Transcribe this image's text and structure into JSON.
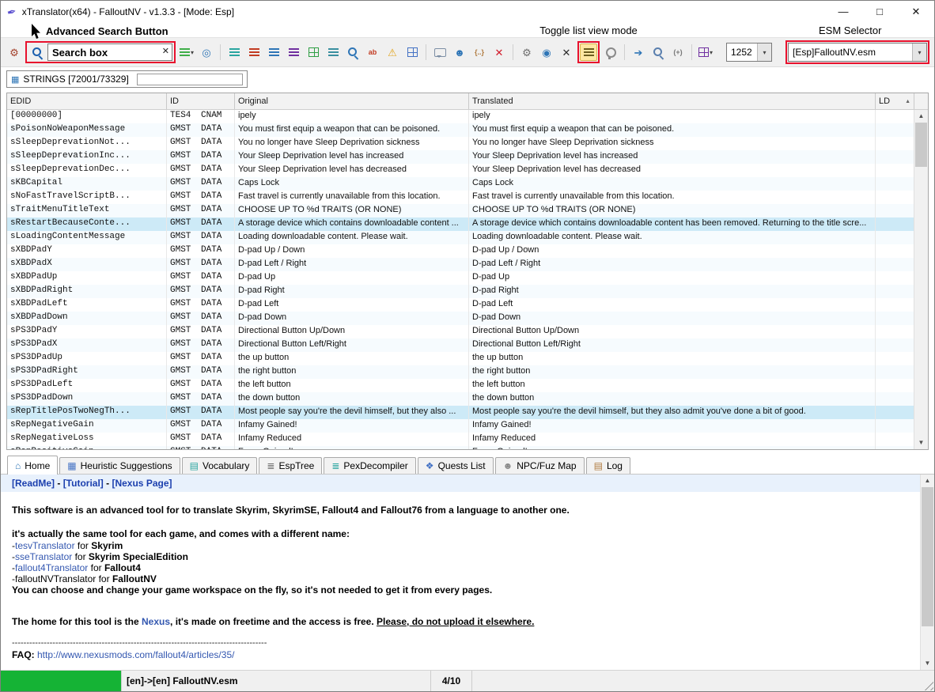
{
  "window": {
    "title": "xTranslator(x64) - FalloutNV - v1.3.3 - [Mode: Esp]",
    "controls": {
      "minimize": "—",
      "maximize": "□",
      "close": "✕"
    }
  },
  "glyphs": {
    "app": "✒",
    "dropdown": "▾",
    "scroll_up": "▲",
    "scroll_down": "▼",
    "clear": "✕",
    "table": "▦",
    "sort": "▲"
  },
  "colors": {
    "annotation_red": "#e8112d",
    "progress_green": "#15b335",
    "link_blue": "#1b3fae",
    "highlight_row": "#cdeaf7"
  },
  "annotations": {
    "advanced_search_label": "Advanced Search Button",
    "toggle_list_label": "Toggle list view mode",
    "esm_selector_label": "ESM Selector"
  },
  "toolbar": {
    "search_text": "Search box",
    "codepage": "1252",
    "esm_file": "[Esp]FalloutNV.esm",
    "icons_left": [
      {
        "name": "options-icon",
        "type": "glyph",
        "glyph": "⚙",
        "color": "#a3402a"
      }
    ],
    "icons_right": [
      {
        "name": "api-translate-icon",
        "type": "lines",
        "color": "#3fae49",
        "dropdown": true
      },
      {
        "name": "web-search-icon",
        "type": "glyph",
        "glyph": "◎",
        "color": "#2e75b6"
      },
      {
        "sep": true
      },
      {
        "name": "list-view-all-icon",
        "type": "lines",
        "color": "#2aa5a0"
      },
      {
        "name": "list-view-untranslated-icon",
        "type": "lines",
        "color": "#c23b22"
      },
      {
        "name": "list-view-translated-icon",
        "type": "lines",
        "color": "#2e75b6"
      },
      {
        "name": "list-view-validated-icon",
        "type": "lines",
        "color": "#7030a0"
      },
      {
        "name": "grid-view-icon",
        "type": "grid",
        "color": "#2f9e44"
      },
      {
        "name": "list-details-icon",
        "type": "lines",
        "color": "#3a8fa0"
      },
      {
        "name": "filter-search-icon",
        "type": "mag",
        "color": "#2e75b6"
      },
      {
        "name": "spellcheck-icon",
        "type": "glyph",
        "glyph": "ab",
        "color": "#c23b22"
      },
      {
        "name": "warnings-icon",
        "type": "glyph",
        "glyph": "⚠",
        "color": "#e2a41c"
      },
      {
        "name": "columns-icon",
        "type": "grid",
        "color": "#4472c4"
      },
      {
        "sep": true
      },
      {
        "name": "comments-icon",
        "type": "bubble",
        "color": "#7d8fa5"
      },
      {
        "name": "npc-voice-icon",
        "type": "glyph",
        "glyph": "☻",
        "color": "#2e75b6"
      },
      {
        "name": "regex-icon",
        "type": "glyph",
        "glyph": "{..}",
        "color": "#b07a3e"
      },
      {
        "name": "clear-translation-icon",
        "type": "glyph",
        "glyph": "✕",
        "color": "#d11a2a"
      },
      {
        "sep": true
      },
      {
        "name": "settings-gear-icon",
        "type": "glyph",
        "glyph": "⚙",
        "color": "#6d6d6d"
      },
      {
        "name": "reload-esp-icon",
        "type": "glyph",
        "glyph": "◉",
        "color": "#2e75b6"
      },
      {
        "name": "close-esp-icon",
        "type": "glyph",
        "glyph": "✕",
        "color": "#2b2b2b"
      },
      {
        "name": "toggle-list-view-icon",
        "type": "lines",
        "color": "#6b5d1e",
        "pressed": true,
        "redbox": true,
        "annotation": "toggle_list_label"
      },
      {
        "name": "hints-bulb-icon",
        "type": "bulb",
        "color": "#8a8a8a"
      },
      {
        "sep": true
      },
      {
        "name": "export-translation-icon",
        "type": "glyph",
        "glyph": "➔",
        "color": "#2e75b6"
      },
      {
        "name": "search-heuristic-icon",
        "type": "mag",
        "color": "#5a7fae"
      },
      {
        "name": "insert-original-icon",
        "type": "glyph",
        "glyph": "(+)",
        "color": "#777777"
      },
      {
        "sep": true
      },
      {
        "name": "color-legend-icon",
        "type": "grid",
        "color": "#7030a0",
        "dropdown": true
      }
    ]
  },
  "strings_bar": {
    "label": "STRINGS [72001/73329]"
  },
  "table": {
    "columns": {
      "edid": "EDID",
      "id": "ID",
      "original": "Original",
      "translated": "Translated",
      "ld": "LD"
    },
    "rows": [
      {
        "edid": "[00000000]",
        "id": "TES4 CNAM",
        "original": "ipely",
        "translated": "ipely"
      },
      {
        "edid": "sPoisonNoWeaponMessage",
        "id": "GMST DATA",
        "original": "You must first equip a weapon that can be poisoned.",
        "translated": "You must first equip a weapon that can be poisoned."
      },
      {
        "edid": "sSleepDeprevationNot...",
        "id": "GMST DATA",
        "original": "You no longer have Sleep Deprivation sickness",
        "translated": "You no longer have Sleep Deprivation sickness"
      },
      {
        "edid": "sSleepDeprevationInc...",
        "id": "GMST DATA",
        "original": "Your Sleep Deprivation level has increased",
        "translated": "Your Sleep Deprivation level has increased"
      },
      {
        "edid": "sSleepDeprevationDec...",
        "id": "GMST DATA",
        "original": "Your Sleep Deprivation level has decreased",
        "translated": "Your Sleep Deprivation level has decreased"
      },
      {
        "edid": "sKBCapital",
        "id": "GMST DATA",
        "original": "Caps Lock",
        "translated": "Caps Lock"
      },
      {
        "edid": "sNoFastTravelScriptB...",
        "id": "GMST DATA",
        "original": "Fast travel is currently unavailable from this location.",
        "translated": "Fast travel is currently unavailable from this location."
      },
      {
        "edid": "sTraitMenuTitleText",
        "id": "GMST DATA",
        "original": "CHOOSE UP TO %d TRAITS (OR NONE)",
        "translated": "CHOOSE UP TO %d TRAITS (OR NONE)"
      },
      {
        "edid": "sRestartBecauseConte...",
        "id": "GMST DATA",
        "original": "A storage device which contains downloadable content ...",
        "translated": "A storage device which contains downloadable content has been removed. Returning to the title scre...",
        "highlight": true
      },
      {
        "edid": "sLoadingContentMessage",
        "id": "GMST DATA",
        "original": "Loading downloadable content. Please wait.",
        "translated": "Loading downloadable content. Please wait."
      },
      {
        "edid": "sXBDPadY",
        "id": "GMST DATA",
        "original": "D-pad Up / Down",
        "translated": "D-pad Up / Down"
      },
      {
        "edid": "sXBDPadX",
        "id": "GMST DATA",
        "original": "D-pad Left / Right",
        "translated": "D-pad Left / Right"
      },
      {
        "edid": "sXBDPadUp",
        "id": "GMST DATA",
        "original": "D-pad Up",
        "translated": "D-pad Up"
      },
      {
        "edid": "sXBDPadRight",
        "id": "GMST DATA",
        "original": "D-pad Right",
        "translated": "D-pad Right"
      },
      {
        "edid": "sXBDPadLeft",
        "id": "GMST DATA",
        "original": "D-pad Left",
        "translated": "D-pad Left"
      },
      {
        "edid": "sXBDPadDown",
        "id": "GMST DATA",
        "original": "D-pad Down",
        "translated": "D-pad Down"
      },
      {
        "edid": "sPS3DPadY",
        "id": "GMST DATA",
        "original": "Directional Button Up/Down",
        "translated": "Directional Button Up/Down"
      },
      {
        "edid": "sPS3DPadX",
        "id": "GMST DATA",
        "original": "Directional Button Left/Right",
        "translated": "Directional Button Left/Right"
      },
      {
        "edid": "sPS3DPadUp",
        "id": "GMST DATA",
        "original": "the up button",
        "translated": "the up button"
      },
      {
        "edid": "sPS3DPadRight",
        "id": "GMST DATA",
        "original": "the right button",
        "translated": "the right button"
      },
      {
        "edid": "sPS3DPadLeft",
        "id": "GMST DATA",
        "original": "the left button",
        "translated": "the left button"
      },
      {
        "edid": "sPS3DPadDown",
        "id": "GMST DATA",
        "original": "the down button",
        "translated": "the down button"
      },
      {
        "edid": "sRepTitlePosTwoNegTh...",
        "id": "GMST DATA",
        "original": "Most people say you're the devil himself, but they also ...",
        "translated": "Most people say you're the devil himself, but they also admit you've done a bit of good.",
        "highlight": true
      },
      {
        "edid": "sRepNegativeGain",
        "id": "GMST DATA",
        "original": "Infamy Gained!",
        "translated": "Infamy Gained!"
      },
      {
        "edid": "sRepNegativeLoss",
        "id": "GMST DATA",
        "original": "Infamy Reduced",
        "translated": "Infamy Reduced"
      },
      {
        "edid": "sRepPositiveGain",
        "id": "GMST DATA",
        "original": "Fame Gained!",
        "translated": "Fame Gained!"
      }
    ]
  },
  "tabs": [
    {
      "label": "Home",
      "icon_name": "home-icon",
      "glyph": "⌂",
      "color": "#2e75b6",
      "active": true
    },
    {
      "label": "Heuristic Suggestions",
      "icon_name": "heuristic-icon",
      "glyph": "▦",
      "color": "#4472c4"
    },
    {
      "label": "Vocabulary",
      "icon_name": "vocabulary-icon",
      "glyph": "▤",
      "color": "#2aa5a0"
    },
    {
      "label": "EspTree",
      "icon_name": "esptree-icon",
      "glyph": "≣",
      "color": "#6d6d6d"
    },
    {
      "label": "PexDecompiler",
      "icon_name": "pexdecompiler-icon",
      "glyph": "≣",
      "color": "#2aa5a0"
    },
    {
      "label": "Quests List",
      "icon_name": "quests-icon",
      "glyph": "❖",
      "color": "#4472c4"
    },
    {
      "label": "NPC/Fuz Map",
      "icon_name": "npcfuz-icon",
      "glyph": "☻",
      "color": "#8a8a8a"
    },
    {
      "label": "Log",
      "icon_name": "log-icon",
      "glyph": "▤",
      "color": "#b07a3e"
    }
  ],
  "home": {
    "nav_readme": "[ReadMe]",
    "nav_sep1": " - ",
    "nav_tutorial": "[Tutorial]",
    "nav_sep2": " - ",
    "nav_nexus": "[Nexus Page]",
    "intro": "This software is an advanced tool for to translate Skyrim, SkyrimSE, Fallout4 and Fallout76 from a language to another one.",
    "same_tool": "it's actually the same tool for each game, and comes with a different name:",
    "tools": [
      {
        "prefix": "-",
        "name": "tesvTranslator",
        "mid": " for ",
        "game": "Skyrim",
        "is_link": true
      },
      {
        "prefix": "-",
        "name": "sseTranslator",
        "mid": " for ",
        "game": "Skyrim SpecialEdition",
        "is_link": true
      },
      {
        "prefix": "-",
        "name": "fallout4Translator",
        "mid": " for ",
        "game": "Fallout4",
        "is_link": true
      },
      {
        "prefix": "-",
        "name": "falloutNVTranslator",
        "mid": " for ",
        "game": "FalloutNV",
        "is_link": false
      }
    ],
    "workspace": "You can choose and change your game workspace on the fly, so it's not needed to get it from every pages.",
    "home_pre": "The home for this tool is the ",
    "home_link": "Nexus",
    "home_mid": ", it's made on freetime and the access is free. ",
    "home_warn": "Please, do not upload it elsewhere.",
    "divider": "----------------------------------------------------------------------------------------",
    "faq_label": "FAQ: ",
    "faq_url": "http://www.nexusmods.com/fallout4/articles/35/"
  },
  "statusbar": {
    "lang_text": "[en]->[en] FalloutNV.esm",
    "count_text": "4/10"
  }
}
